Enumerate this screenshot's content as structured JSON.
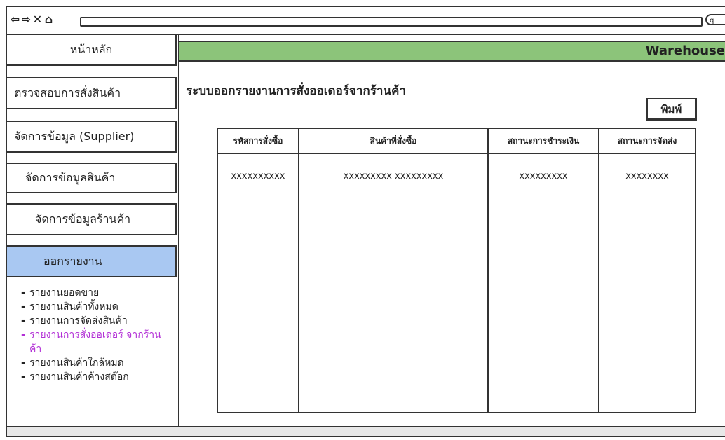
{
  "browser": {
    "nav": [
      "⇦",
      "⇨",
      "✕",
      "⌂"
    ],
    "search_icon": "q"
  },
  "sidebar": {
    "items": [
      {
        "label": "หน้าหลัก"
      },
      {
        "label": "ตรวจสอบการสั่งสินค้า"
      },
      {
        "label": "จัดการข้อมูล (Supplier)"
      },
      {
        "label": "จัดการข้อมูลสินค้า"
      },
      {
        "label": "จัดการข้อมูลร้านค้า"
      },
      {
        "label": "ออกรายงาน"
      }
    ],
    "submenu": [
      "รายงานยอดขาย",
      "รายงานสินค้าทั้งหมด",
      "รายงานการจัดส่งสินค้า",
      "รายงานการสั่งออเดอร์ จากร้านค้า",
      "รายงานสินค้าใกล้หมด",
      "รายงานสินค้าค้างสต๊อก"
    ]
  },
  "header": {
    "title": "Warehouse"
  },
  "main": {
    "title": "ระบบออกรายงานการสั่งออเดอร์จากร้านค้า",
    "print_label": "พิมพ์",
    "table": {
      "headers": [
        "รหัสการสั่งซื้อ",
        "สินค้าที่สั่งซื้อ",
        "สถานะการชำระเงิน",
        "สถานะการจัดส่ง"
      ],
      "row": [
        "xxxxxxxxxx",
        "xxxxxxxxx xxxxxxxxx",
        "xxxxxxxxx",
        "xxxxxxxx"
      ]
    }
  }
}
